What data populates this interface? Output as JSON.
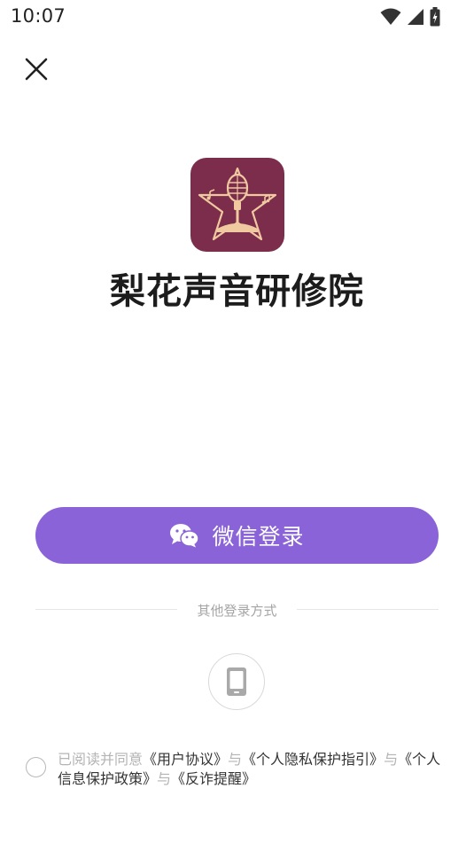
{
  "status_bar": {
    "time": "10:07"
  },
  "app": {
    "name": "梨花声音研修院"
  },
  "login": {
    "wechat_label": "微信登录"
  },
  "other_methods": {
    "label": "其他登录方式"
  },
  "agreement": {
    "prefix": "已阅读并同意",
    "link1": "《用户协议》",
    "sep1": "与",
    "link2": "《个人隐私保护指引》",
    "sep2": "与",
    "link3": "《个人信息保护政策》",
    "sep3": "与",
    "link4": "《反诈提醒》"
  },
  "colors": {
    "primary": "#8a63d8",
    "logo_bg": "#7b2d4b",
    "logo_gold": "#f0c9a0"
  },
  "icons": {
    "close": "close-icon",
    "wechat": "wechat-icon",
    "phone": "phone-icon",
    "wifi": "wifi-icon",
    "signal": "signal-icon",
    "battery": "battery-icon"
  }
}
